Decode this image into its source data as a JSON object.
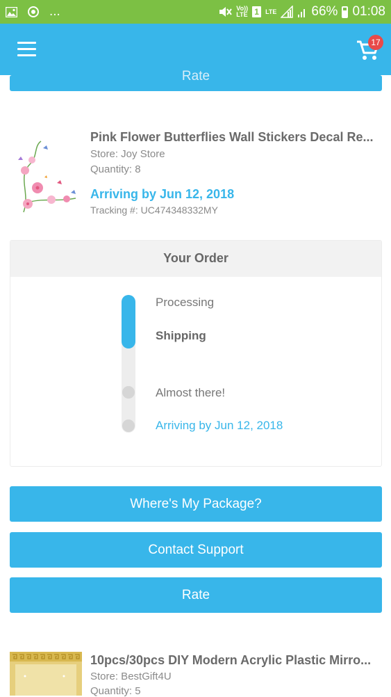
{
  "status_bar": {
    "left_extra": "...",
    "volte_line1": "Vo))",
    "volte_line2": "LTE",
    "sim": "1",
    "network": "LTE",
    "battery": "66%",
    "time": "01:08"
  },
  "app_bar": {
    "cart_count": "17",
    "icons": [
      "menu-icon",
      "cart-icon"
    ]
  },
  "top_button": {
    "label": "Rate"
  },
  "item1": {
    "title": "Pink Flower Butterflies Wall Stickers Decal Re...",
    "store": "Store: Joy Store",
    "quantity": "Quantity: 8",
    "arriving": "Arriving by Jun 12, 2018",
    "tracking": "Tracking #: UC474348332MY"
  },
  "order": {
    "header": "Your Order",
    "steps": [
      "Processing",
      "Shipping",
      "Almost there!",
      "Arriving by Jun 12, 2018"
    ],
    "progress_fraction": 0.35
  },
  "buttons": {
    "where": "Where's My Package?",
    "contact": "Contact Support",
    "rate": "Rate"
  },
  "item2": {
    "title": "10pcs/30pcs DIY Modern Acrylic Plastic Mirro...",
    "store": "Store: BestGift4U",
    "quantity": "Quantity: 5"
  },
  "colors": {
    "status_bar": "#7cc044",
    "accent": "#38b6ea",
    "badge": "#e84a4a"
  }
}
